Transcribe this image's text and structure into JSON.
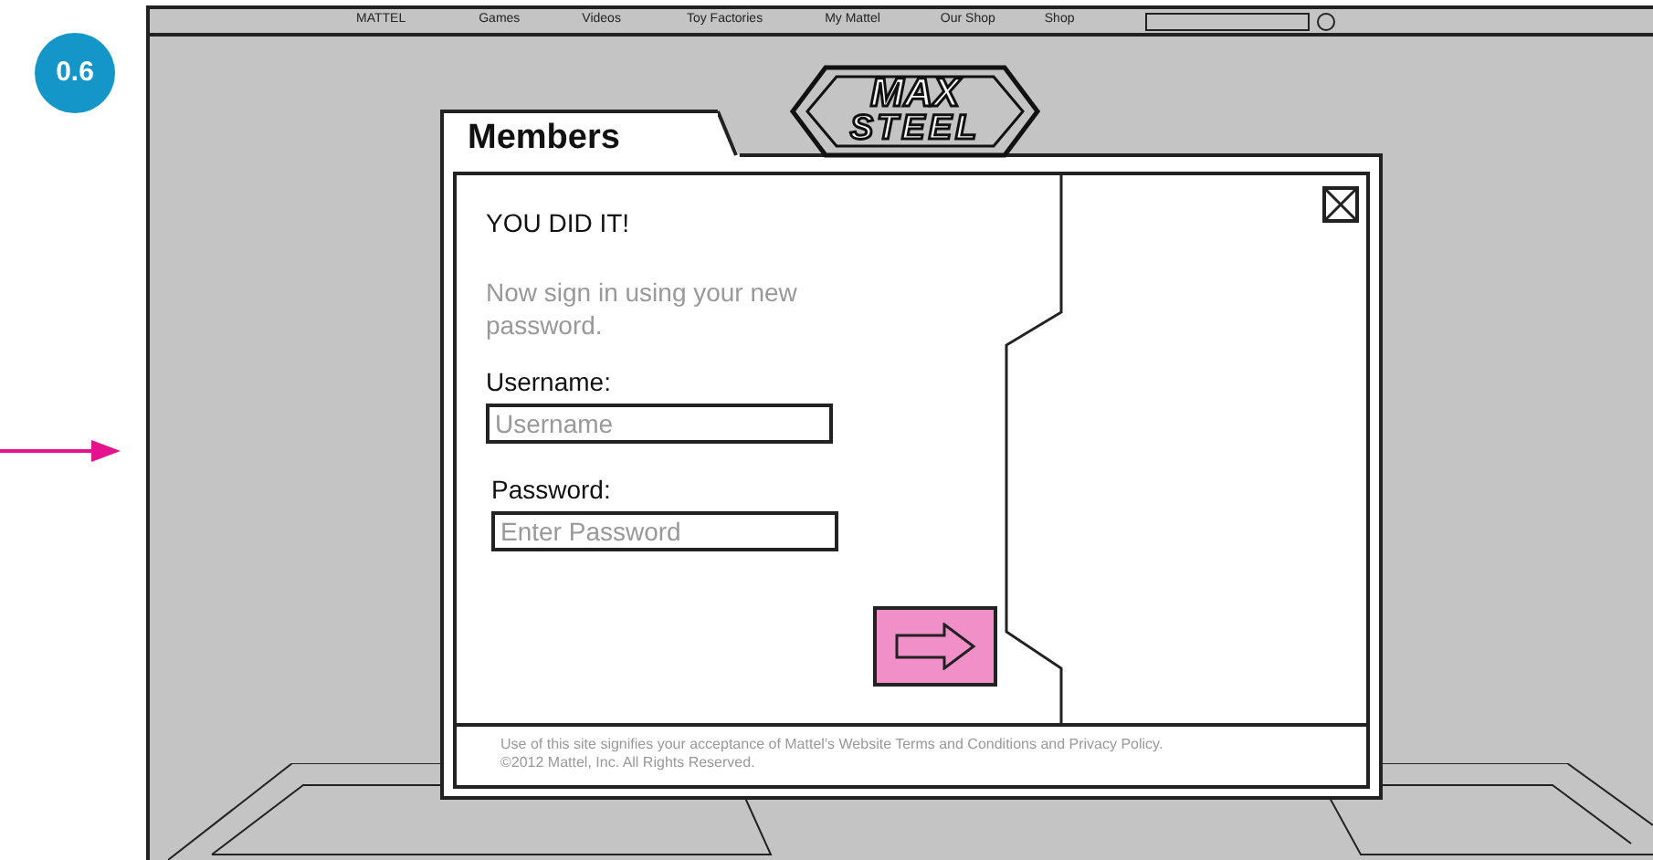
{
  "badge": "0.6",
  "nav": {
    "items": [
      "MATTEL",
      "Games",
      "Videos",
      "Toy Factories",
      "My Mattel",
      "Our Shop",
      "Shop"
    ]
  },
  "logo": {
    "lines": [
      "MAX",
      "STEEL"
    ]
  },
  "modal": {
    "tab": "Members",
    "title": "YOU DID IT!",
    "message": "Now sign in using your new password.",
    "fields": [
      {
        "label": "Username:",
        "placeholder": "Username"
      },
      {
        "label": "Password:",
        "placeholder": "Enter Password"
      }
    ],
    "footer": [
      "Use of this site signifies your acceptance of Mattel’s Website Terms and Conditions and Privacy Policy.",
      "©2012 Mattel, Inc. All Rights Reserved."
    ]
  }
}
